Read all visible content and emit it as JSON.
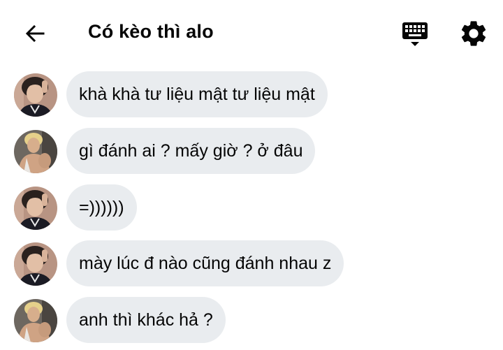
{
  "header": {
    "title": "Có kèo thì alo",
    "back_icon": "arrow-left-icon",
    "keyboard_icon": "keyboard-icon",
    "settings_icon": "gear-icon"
  },
  "messages": [
    {
      "sender": "avatar-a",
      "text": "khà khà tư liệu mật tư liệu mật"
    },
    {
      "sender": "avatar-b",
      "text": "gì đánh ai ? mấy giờ ? ở đâu"
    },
    {
      "sender": "avatar-a",
      "text": "=))))))"
    },
    {
      "sender": "avatar-a",
      "text": "mày lúc đ nào cũng đánh nhau z"
    },
    {
      "sender": "avatar-b",
      "text": "anh thì khác hả ?"
    }
  ],
  "colors": {
    "bubble": "#e9ecef",
    "text": "#050505",
    "background": "#ffffff"
  }
}
